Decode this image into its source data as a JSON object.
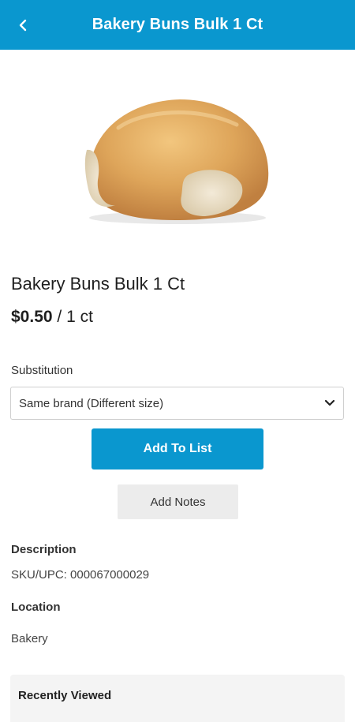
{
  "header": {
    "title": "Bakery Buns Bulk 1 Ct",
    "back_icon": "chevron-left-icon"
  },
  "product": {
    "image_subject": "bakery-bun-image",
    "name": "Bakery Buns Bulk 1 Ct",
    "price": "$0.50",
    "unit": "/ 1 ct"
  },
  "substitution": {
    "label": "Substitution",
    "selected": "Same brand (Different size)"
  },
  "actions": {
    "add_to_list": "Add To List",
    "add_notes": "Add Notes"
  },
  "description": {
    "heading": "Description",
    "text": "SKU/UPC: 000067000029"
  },
  "location": {
    "heading": "Location",
    "text": "Bakery"
  },
  "recently_viewed": {
    "heading": "Recently Viewed"
  },
  "colors": {
    "accent": "#0a97cf",
    "secondary_button": "#ececec"
  }
}
